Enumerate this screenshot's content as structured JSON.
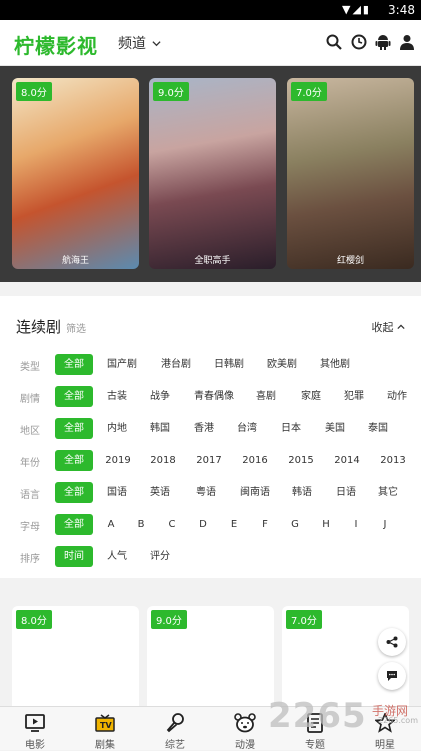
{
  "status": {
    "time": "3:48"
  },
  "header": {
    "logo": "柠檬影视",
    "channel": "频道"
  },
  "banner": [
    {
      "rating": "8.0分",
      "title": "航海王"
    },
    {
      "rating": "9.0分",
      "title": "全职高手"
    },
    {
      "rating": "7.0分",
      "title": "红樱剑"
    }
  ],
  "filter": {
    "title": "连续剧",
    "subtitle": "筛选",
    "fold": "收起",
    "rows": [
      {
        "label": "类型",
        "options": [
          "全部",
          "国产剧",
          "港台剧",
          "日韩剧",
          "欧美剧",
          "其他剧"
        ]
      },
      {
        "label": "剧情",
        "options": [
          "全部",
          "古装",
          "战争",
          "青春偶像",
          "喜剧",
          "家庭",
          "犯罪",
          "动作"
        ]
      },
      {
        "label": "地区",
        "options": [
          "全部",
          "内地",
          "韩国",
          "香港",
          "台湾",
          "日本",
          "美国",
          "泰国"
        ]
      },
      {
        "label": "年份",
        "options": [
          "全部",
          "2019",
          "2018",
          "2017",
          "2016",
          "2015",
          "2014",
          "2013"
        ]
      },
      {
        "label": "语言",
        "options": [
          "全部",
          "国语",
          "英语",
          "粤语",
          "闽南语",
          "韩语",
          "日语",
          "其它"
        ]
      },
      {
        "label": "字母",
        "options": [
          "全部",
          "A",
          "B",
          "C",
          "D",
          "E",
          "F",
          "G",
          "H",
          "I",
          "J"
        ]
      },
      {
        "label": "排序",
        "options": [
          "时间",
          "人气",
          "评分"
        ]
      }
    ]
  },
  "cards": [
    {
      "rating": "8.0分"
    },
    {
      "rating": "9.0分"
    },
    {
      "rating": "7.0分"
    }
  ],
  "tabs": [
    {
      "label": "电影",
      "icon": "movie-icon"
    },
    {
      "label": "剧集",
      "icon": "tv-icon"
    },
    {
      "label": "综艺",
      "icon": "microphone-icon"
    },
    {
      "label": "动漫",
      "icon": "bear-icon"
    },
    {
      "label": "专题",
      "icon": "topic-icon"
    },
    {
      "label": "明星",
      "icon": "star-icon"
    }
  ],
  "watermark": {
    "main": "2265",
    "suffix": "手游网",
    "url": "2265.com"
  },
  "colors": {
    "accent": "#2db92d",
    "banner_bg": "#3a3a3a"
  }
}
